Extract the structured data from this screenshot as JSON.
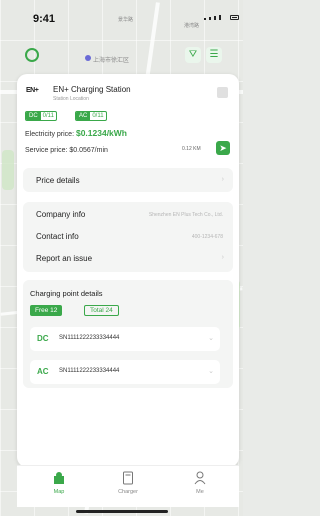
{
  "status_bar": {
    "time": "9:41"
  },
  "map": {
    "labels": [
      "景华路",
      "港湾路"
    ],
    "city_label": "上海市徐汇区"
  },
  "station": {
    "logo_text": "EN+",
    "name": "EN+ Charging Station",
    "location": "Station Location",
    "dc_label": "DC",
    "dc_value": "0/11",
    "ac_label": "AC",
    "ac_value": "0/11",
    "electricity_label": "Electricity price:",
    "electricity_value": "$0.1234/kWh",
    "service_label": "Service price:",
    "service_value": "$0.0567/min",
    "distance": "0.12 KM"
  },
  "price_details": {
    "label": "Price details"
  },
  "info": {
    "company_label": "Company info",
    "company_value": "Shenzhen EN Plus Tech Co., Ltd.",
    "contact_label": "Contact info",
    "contact_value": "400-1234-678",
    "report_label": "Report an issue"
  },
  "charging_points": {
    "title": "Charging point details",
    "free_label": "Free 12",
    "total_label": "Total 24",
    "connectors": [
      {
        "type": "DC",
        "serial": "SN1111222233334444"
      },
      {
        "type": "AC",
        "serial": "SN1111222233334444"
      }
    ]
  },
  "tabs": [
    {
      "label": "Map",
      "active": true
    },
    {
      "label": "Charger",
      "active": false
    },
    {
      "label": "Me",
      "active": false
    }
  ],
  "colors": {
    "accent": "#3aa84a",
    "bg": "#e9ebe8"
  }
}
